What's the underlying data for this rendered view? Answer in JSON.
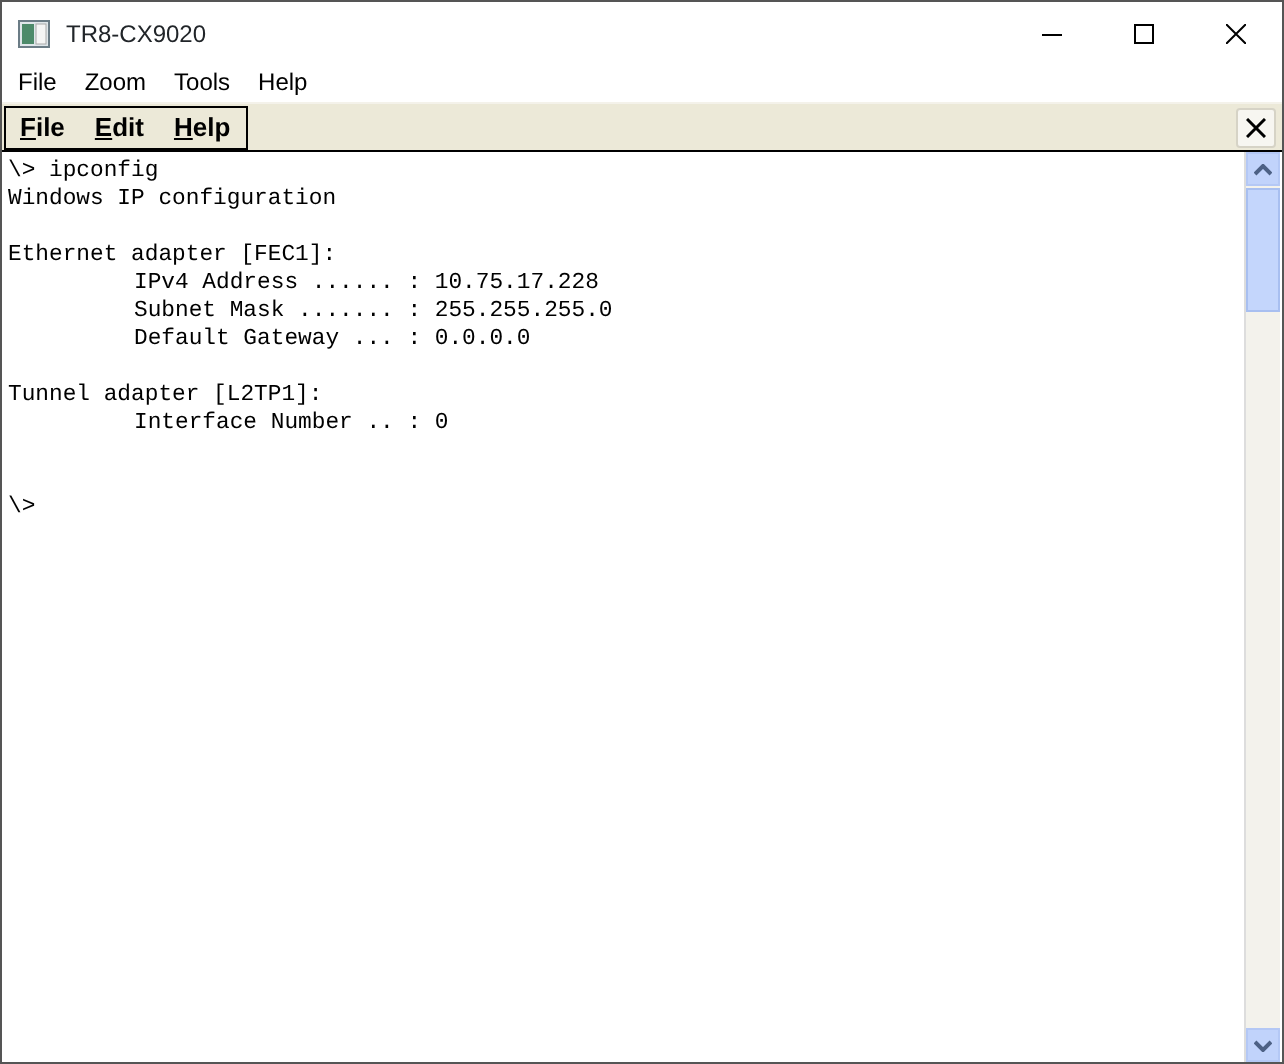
{
  "window": {
    "title": "TR8-CX9020"
  },
  "menu_bar": [
    "File",
    "Zoom",
    "Tools",
    "Help"
  ],
  "toolbar": {
    "menus": [
      "File",
      "Edit",
      "Help"
    ]
  },
  "terminal": {
    "lines": [
      {
        "kind": "line",
        "text": "\\> ipconfig"
      },
      {
        "kind": "line",
        "text": "Windows IP configuration"
      },
      {
        "kind": "blank"
      },
      {
        "kind": "line",
        "text": "Ethernet adapter [FEC1]:"
      },
      {
        "kind": "indented",
        "text": "IPv4 Address ...... : 10.75.17.228"
      },
      {
        "kind": "indented",
        "text": "Subnet Mask ....... : 255.255.255.0"
      },
      {
        "kind": "indented",
        "text": "Default Gateway ... : 0.0.0.0"
      },
      {
        "kind": "blank"
      },
      {
        "kind": "line",
        "text": "Tunnel adapter [L2TP1]:"
      },
      {
        "kind": "indented",
        "text": "Interface Number .. : 0"
      },
      {
        "kind": "blank"
      },
      {
        "kind": "blank"
      },
      {
        "kind": "line",
        "text": "\\>"
      }
    ]
  }
}
